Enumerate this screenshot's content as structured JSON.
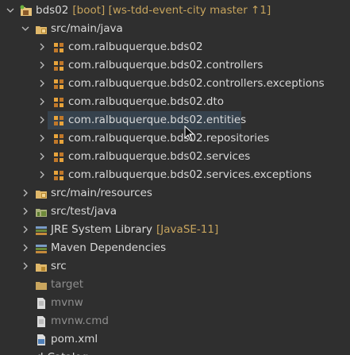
{
  "tree": {
    "project": {
      "name": "bds02",
      "decoration": "[boot] [ws-tdd-event-city master ↑1]"
    },
    "src_main_java": "src/main/java",
    "packages": [
      "com.ralbuquerque.bds02",
      "com.ralbuquerque.bds02.controllers",
      "com.ralbuquerque.bds02.controllers.exceptions",
      "com.ralbuquerque.bds02.dto",
      "com.ralbuquerque.bds02.entities",
      "com.ralbuquerque.bds02.repositories",
      "com.ralbuquerque.bds02.services",
      "com.ralbuquerque.bds02.services.exceptions"
    ],
    "selected_package": "com.ralbuquerque.bds02.entities",
    "src_main_resources": "src/main/resources",
    "src_test_java": "src/test/java",
    "jre_library": {
      "name": "JRE System Library",
      "decoration": "[JavaSE-11]"
    },
    "maven_dependencies": "Maven Dependencies",
    "src": "src",
    "target": "target",
    "mvnw": "mvnw",
    "mvnw_cmd": "mvnw.cmd",
    "pom": "pom.xml",
    "partial_next": "d-Catalog"
  },
  "colors": {
    "background": "#2f2f2f",
    "selection": "#36424d",
    "decoration": "#c7a45d",
    "text": "#d9d9d9",
    "dim_text": "#8e8e8e"
  }
}
